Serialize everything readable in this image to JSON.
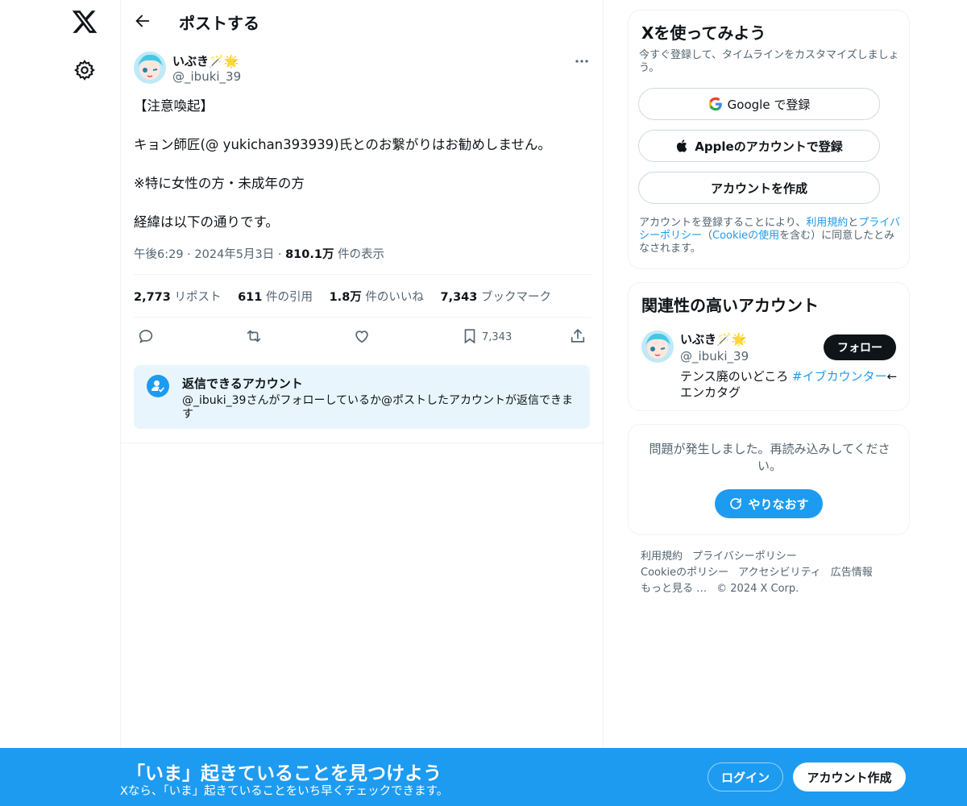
{
  "nav": {
    "logo_icon": "x-logo-icon",
    "settings_icon": "gear-icon"
  },
  "header": {
    "title": "ポストする"
  },
  "post": {
    "author_name": "いぶき🪄🌟",
    "author_handle": "@_ibuki_39",
    "lines": [
      "【注意喚起】",
      "キョン師匠(@ yukichan393939)氏とのお繋がりはお勧めしません。",
      "※特に女性の方・未成年の方",
      "経緯は以下の通りです。"
    ],
    "time": "午後6:29",
    "date": "2024年5月3日",
    "views_count": "810.1万",
    "views_label": "件の表示",
    "stats": {
      "reposts_count": "2,773",
      "reposts_label": "リポスト",
      "quotes_count": "611",
      "quotes_label": "件の引用",
      "likes_count": "1.8万",
      "likes_label": "件のいいね",
      "bookmarks_count": "7,343",
      "bookmarks_label": "ブックマーク"
    },
    "bookmark_action_count": "7,343"
  },
  "reply_restriction": {
    "title": "返信できるアカウント",
    "description": "@_ibuki_39さんがフォローしているか@ポストしたアカウントが返信できます"
  },
  "signup_card": {
    "title": "Xを使ってみよう",
    "subtitle": "今すぐ登録して、タイムラインをカスタマイズしましょう。",
    "google_label": "Google で登録",
    "apple_label": "Appleのアカウントで登録",
    "create_label": "アカウントを作成",
    "terms_prefix": "アカウントを登録することにより、",
    "terms_link": "利用規約",
    "terms_and": "と",
    "privacy_link": "プライバシーポリシー",
    "cookie_open": "（",
    "cookie_link": "Cookieの使用",
    "terms_suffix": "を含む）に同意したとみなされます。"
  },
  "related": {
    "title": "関連性の高いアカウント",
    "name": "いぶき🪄🌟",
    "handle": "@_ibuki_39",
    "follow_label": "フォロー",
    "bio_prefix": "テンス廃のいどころ ",
    "bio_tag": "#イブカウンター",
    "bio_suffix": "←エンカタグ"
  },
  "error_card": {
    "message": "問題が発生しました。再読み込みしてください。",
    "retry_label": "やりなおす"
  },
  "footer": {
    "links": [
      "利用規約",
      "プライバシーポリシー",
      "Cookieのポリシー",
      "アクセシビリティ",
      "広告情報",
      "もっと見る …"
    ],
    "copyright": "© 2024 X Corp."
  },
  "bottom_bar": {
    "title": "「いま」起きていることを見つけよう",
    "subtitle": "Xなら、「いま」起きていることをいち早くチェックできます。",
    "login_label": "ログイン",
    "signup_label": "アカウント作成"
  },
  "colors": {
    "accent": "#1d9bf0",
    "text": "#0f1419",
    "muted": "#536471"
  }
}
